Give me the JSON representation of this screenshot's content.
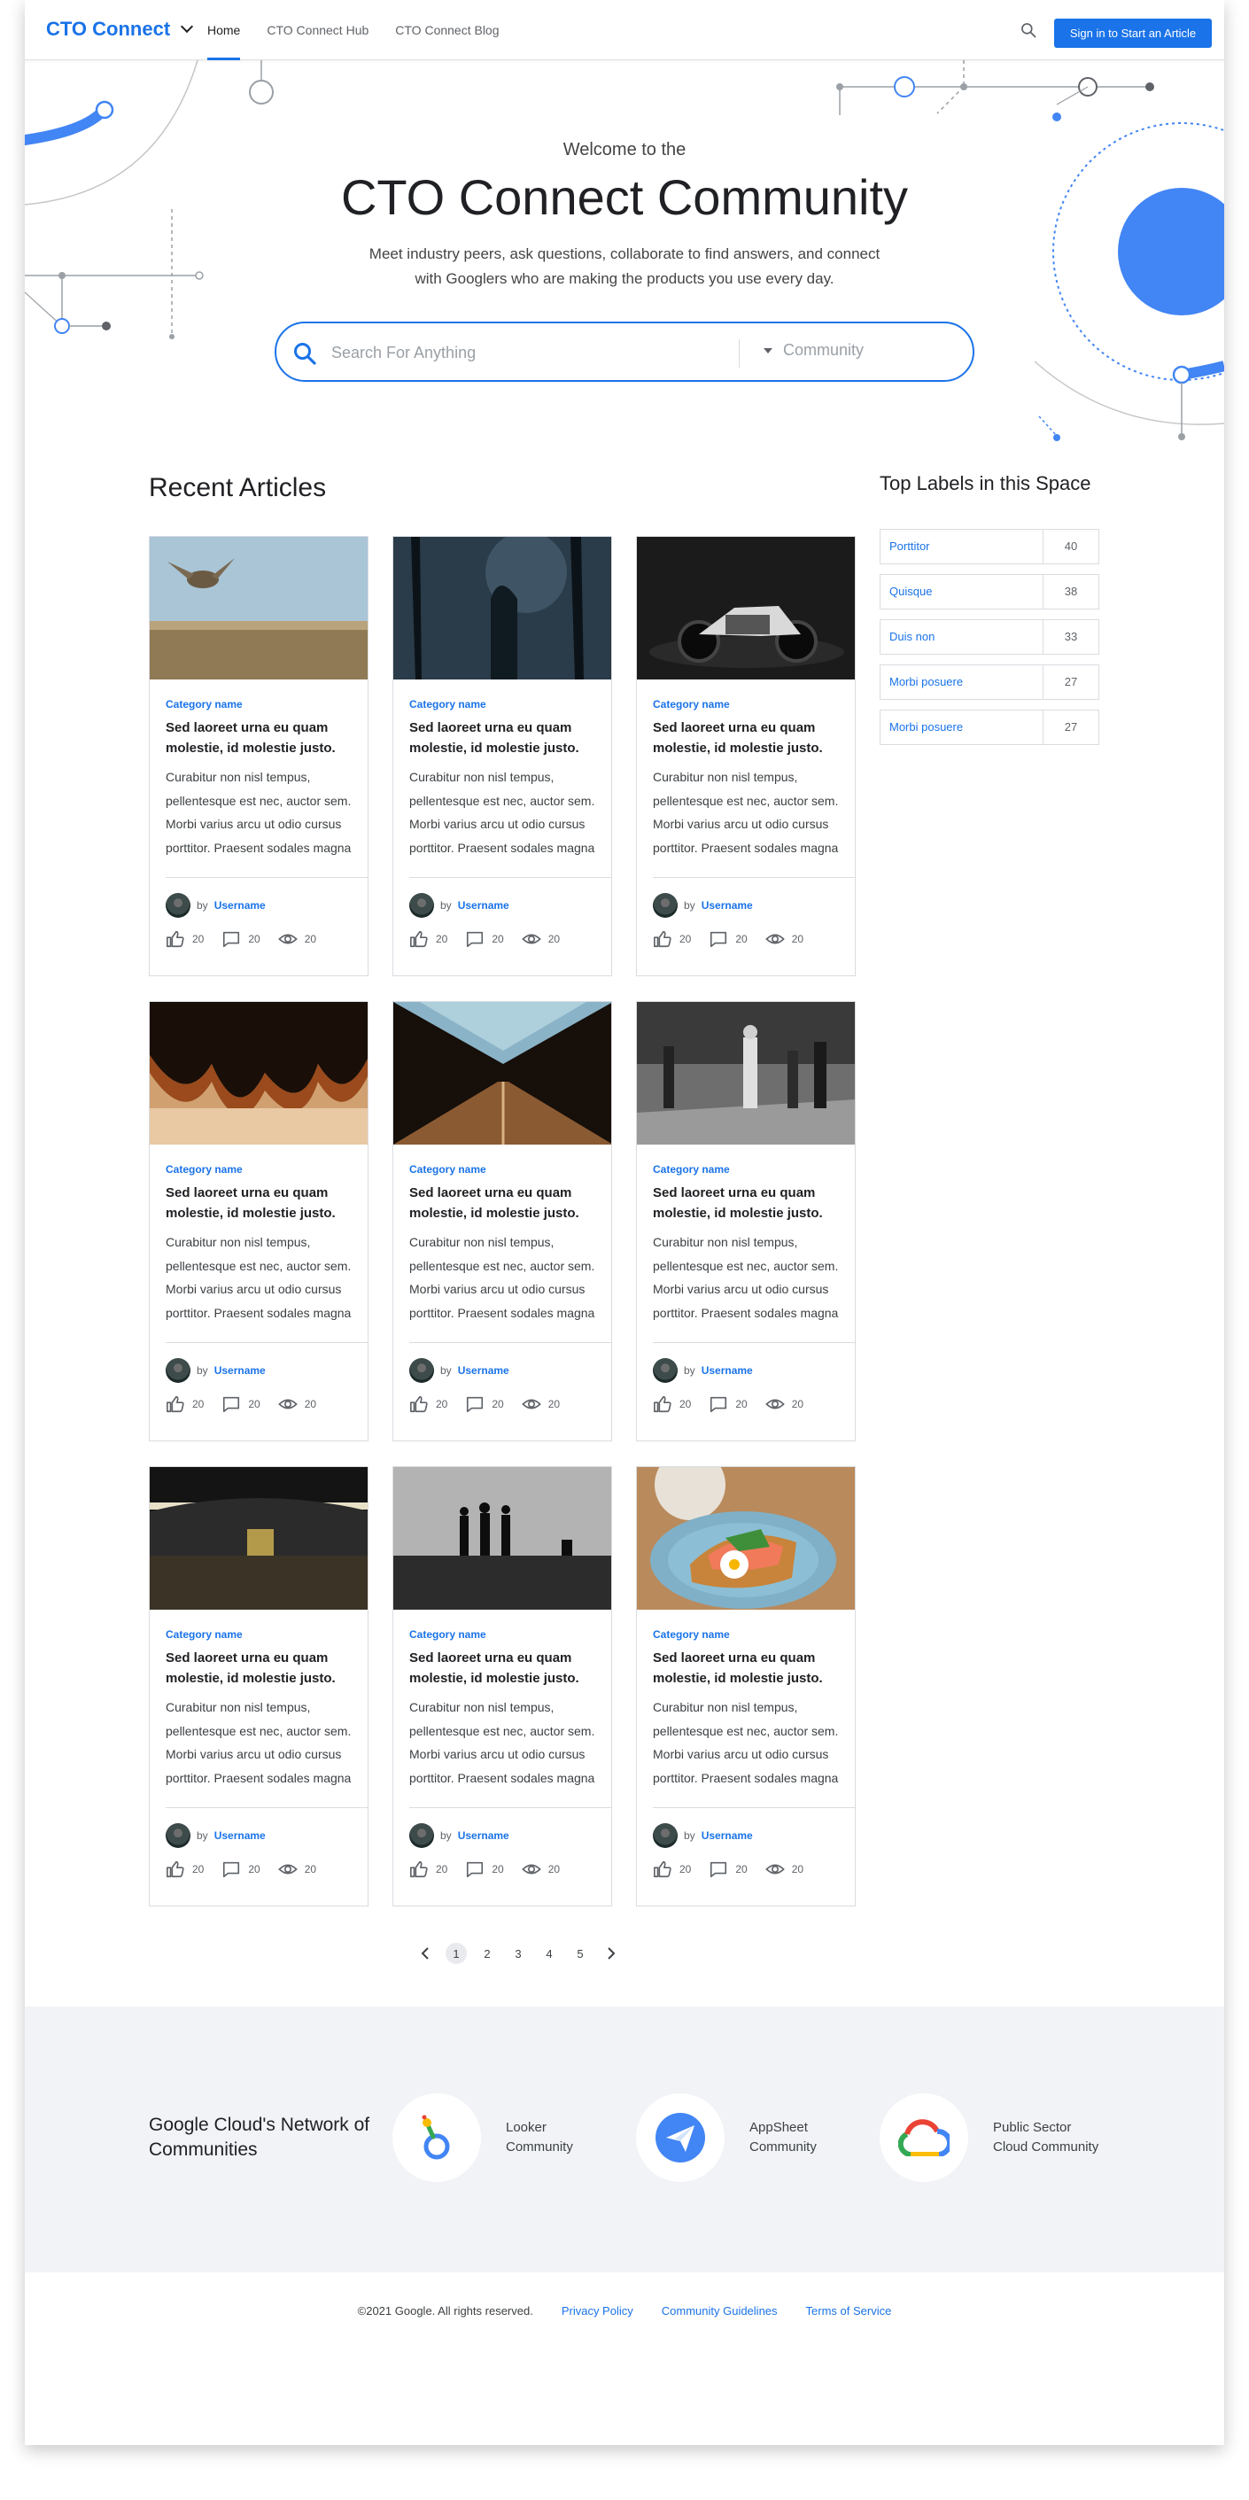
{
  "header": {
    "logo_text": "CTO Connect",
    "nav": [
      "Home",
      "CTO Connect Hub",
      "CTO Connect Blog"
    ],
    "signin_label": "Sign in to Start an Article",
    "icons": {
      "search": "search-icon",
      "logo_menu": "chevron-down-icon"
    }
  },
  "hero": {
    "welcome": "Welcome to the",
    "title": "CTO Connect Community",
    "description": "Meet industry peers, ask questions, collaborate to find answers, and connect with Googlers who are making the products you use every day.",
    "search_placeholder": "Search For Anything",
    "scope_label": "Community"
  },
  "recent": {
    "title": "Recent Articles",
    "by": "by",
    "cards": [
      {
        "category": "Category name",
        "title": "Sed laoreet urna eu quam molestie, id molestie justo.",
        "excerpt": [
          "Curabitur non nisl tempus,",
          "pellentesque est nec, auctor sem.",
          "Morbi varius arcu ut odio cursus",
          "porttitor. Praesent sodales magna"
        ],
        "author": "Username",
        "likes": "20",
        "comments": "20",
        "views": "20",
        "image": "owl"
      },
      {
        "category": "Category name",
        "title": "Sed laoreet urna eu quam molestie, id molestie justo.",
        "excerpt": [
          "Curabitur non nisl tempus,",
          "pellentesque est nec, auctor sem.",
          "Morbi varius arcu ut odio cursus",
          "porttitor. Praesent sodales magna"
        ],
        "author": "Username",
        "likes": "20",
        "comments": "20",
        "views": "20",
        "image": "forest"
      },
      {
        "category": "Category name",
        "title": "Sed laoreet urna eu quam molestie, id molestie justo.",
        "excerpt": [
          "Curabitur non nisl tempus,",
          "pellentesque est nec, auctor sem.",
          "Morbi varius arcu ut odio cursus",
          "porttitor. Praesent sodales magna"
        ],
        "author": "Username",
        "likes": "20",
        "comments": "20",
        "views": "20",
        "image": "motorcycle"
      },
      {
        "category": "Category name",
        "title": "Sed laoreet urna eu quam molestie, id molestie justo.",
        "excerpt": [
          "Curabitur non nisl tempus,",
          "pellentesque est nec, auctor sem.",
          "Morbi varius arcu ut odio cursus",
          "porttitor. Praesent sodales magna"
        ],
        "author": "Username",
        "likes": "20",
        "comments": "20",
        "views": "20",
        "image": "abstract"
      },
      {
        "category": "Category name",
        "title": "Sed laoreet urna eu quam molestie, id molestie justo.",
        "excerpt": [
          "Curabitur non nisl tempus,",
          "pellentesque est nec, auctor sem.",
          "Morbi varius arcu ut odio cursus",
          "porttitor. Praesent sodales magna"
        ],
        "author": "Username",
        "likes": "20",
        "comments": "20",
        "views": "20",
        "image": "pyramid"
      },
      {
        "category": "Category name",
        "title": "Sed laoreet urna eu quam molestie, id molestie justo.",
        "excerpt": [
          "Curabitur non nisl tempus,",
          "pellentesque est nec, auctor sem.",
          "Morbi varius arcu ut odio cursus",
          "porttitor. Praesent sodales magna"
        ],
        "author": "Username",
        "likes": "20",
        "comments": "20",
        "views": "20",
        "image": "street"
      },
      {
        "category": "Category name",
        "title": "Sed laoreet urna eu quam molestie, id molestie justo.",
        "excerpt": [
          "Curabitur non nisl tempus,",
          "pellentesque est nec, auctor sem.",
          "Morbi varius arcu ut odio cursus",
          "porttitor. Praesent sodales magna"
        ],
        "author": "Username",
        "likes": "20",
        "comments": "20",
        "views": "20",
        "image": "garage"
      },
      {
        "category": "Category name",
        "title": "Sed laoreet urna eu quam molestie, id molestie justo.",
        "excerpt": [
          "Curabitur non nisl tempus,",
          "pellentesque est nec, auctor sem.",
          "Morbi varius arcu ut odio cursus",
          "porttitor. Praesent sodales magna"
        ],
        "author": "Username",
        "likes": "20",
        "comments": "20",
        "views": "20",
        "image": "silhouettes"
      },
      {
        "category": "Category name",
        "title": "Sed laoreet urna eu quam molestie, id molestie justo.",
        "excerpt": [
          "Curabitur non nisl tempus,",
          "pellentesque est nec, auctor sem.",
          "Morbi varius arcu ut odio cursus",
          "porttitor. Praesent sodales magna"
        ],
        "author": "Username",
        "likes": "20",
        "comments": "20",
        "views": "20",
        "image": "food"
      }
    ]
  },
  "pagination": {
    "pages": [
      "1",
      "2",
      "3",
      "4",
      "5"
    ],
    "current": "1"
  },
  "labels": {
    "title": "Top Labels in this Space",
    "items": [
      {
        "name": "Porttitor",
        "count": "40"
      },
      {
        "name": "Quisque",
        "count": "38"
      },
      {
        "name": "Duis non",
        "count": "33"
      },
      {
        "name": "Morbi posuere",
        "count": "27"
      },
      {
        "name": "Morbi posuere",
        "count": "27"
      }
    ]
  },
  "network": {
    "title": "Google Cloud's Network of Communities",
    "communities": [
      {
        "line1": "Looker",
        "line2": "Community",
        "icon": "looker-logo-icon"
      },
      {
        "line1": "AppSheet",
        "line2": "Community",
        "icon": "appsheet-logo-icon"
      },
      {
        "line1": "Public Sector",
        "line2": "Cloud Community",
        "icon": "google-cloud-logo-icon"
      }
    ]
  },
  "footer": {
    "copyright": "©2021 Google. All rights reserved.",
    "links": [
      "Privacy Policy",
      "Community Guidelines",
      "Terms of Service"
    ]
  },
  "colors": {
    "accent": "#1a73e8",
    "band": "#f1f3f6",
    "text": "#202124"
  }
}
